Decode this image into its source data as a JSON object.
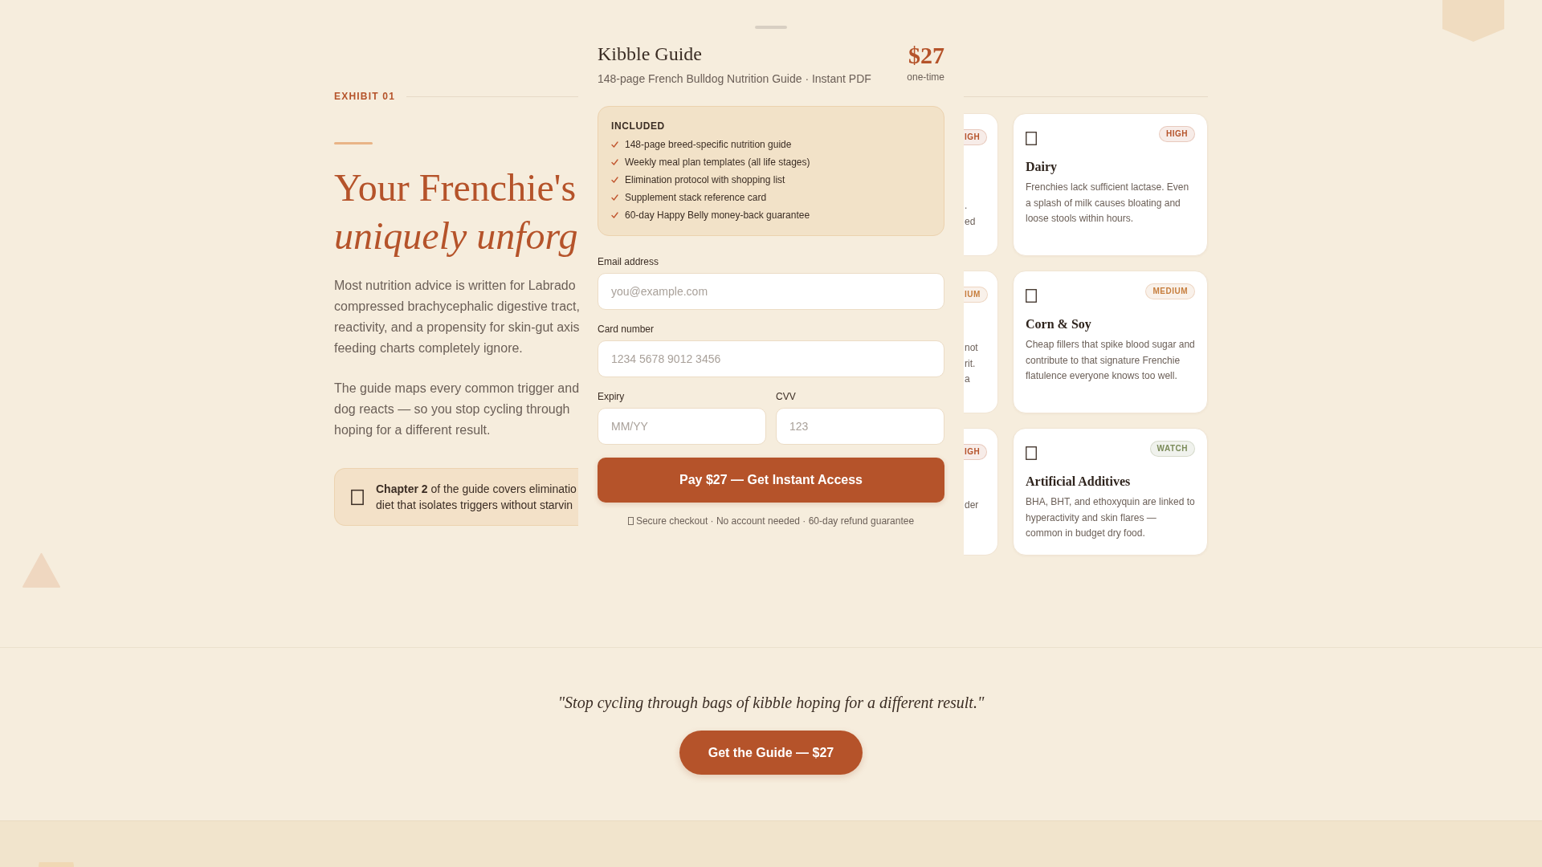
{
  "intro": {
    "exhibit_label": "EXHIBIT 01",
    "heading": {
      "line_1": "Your Frenchie's",
      "line_2": "uniquely unforg"
    },
    "paragraphs": [
      {
        "lines": [
          "Most nutrition advice is written for Labrado",
          "compressed brachycephalic digestive tract,",
          "reactivity, and a propensity for skin-gut axis",
          "feeding charts completely ignore."
        ]
      },
      {
        "lines": [
          "The guide maps every common trigger and",
          "dog reacts — so you stop cycling through",
          "hoping for a different result."
        ]
      }
    ],
    "callout": {
      "lines": [
        "**Chapter 2** of the guide covers eliminatio",
        "diet that isolates triggers without starvin"
      ]
    }
  },
  "checkout_sheet": {
    "title": "Kibble Guide",
    "subtitle": "148-page French Bulldog Nutrition Guide · Instant PDF",
    "price": "$27",
    "price_note": "one-time",
    "included": {
      "heading": "INCLUDED",
      "items": [
        "148-page breed-specific nutrition guide",
        "Weekly meal plan templates (all life stages)",
        "Elimination protocol with shopping list",
        "Supplement stack reference card",
        "60-day Happy Belly money-back guarantee"
      ]
    },
    "fields": [
      {
        "label": "Email address",
        "placeholder": "you@example.com"
      },
      {
        "label": "Card number",
        "placeholder": "1234 5678 9012 3456"
      },
      {
        "label": "Expiry",
        "placeholder": "MM/YY"
      },
      {
        "label": "CVV",
        "placeholder": "123"
      }
    ],
    "pay_button": "Pay $27 — Get Instant Access",
    "secure_note": "Secure checkout · No account needed · 60-day refund guarantee"
  },
  "partly_hidden_cards": [
    {
      "badge": "IGH",
      "color": "#b5532a",
      "text_fragments": [
        ".",
        "ed"
      ]
    },
    {
      "badge": "IUM",
      "color": "#c67d3c",
      "text_fragments": [
        "not",
        "rit.",
        "a"
      ]
    },
    {
      "badge": "IGH",
      "color": "#b5532a",
      "text_fragments": [
        "der"
      ]
    }
  ],
  "trigger_cards": [
    {
      "badge": "HIGH",
      "color": "#b5532a",
      "title": "Dairy",
      "description": "Frenchies lack sufficient lactase. Even a splash of milk causes bloating and loose stools within hours."
    },
    {
      "badge": "MEDIUM",
      "color": "#c67d3c",
      "title": "Corn & Soy",
      "description": "Cheap fillers that spike blood sugar and contribute to that signature Frenchie flatulence everyone knows too well."
    },
    {
      "badge": "WATCH",
      "color": "#7a8a58",
      "title": "Artificial Additives",
      "description": "BHA, BHT, and ethoxyquin are linked to hyperactivity and skin flares — common in budget dry food."
    }
  ],
  "quote_section": {
    "quote": "\"Stop cycling through bags of kibble hoping for a different result.\"",
    "cta_button": "Get the Guide — $27"
  }
}
